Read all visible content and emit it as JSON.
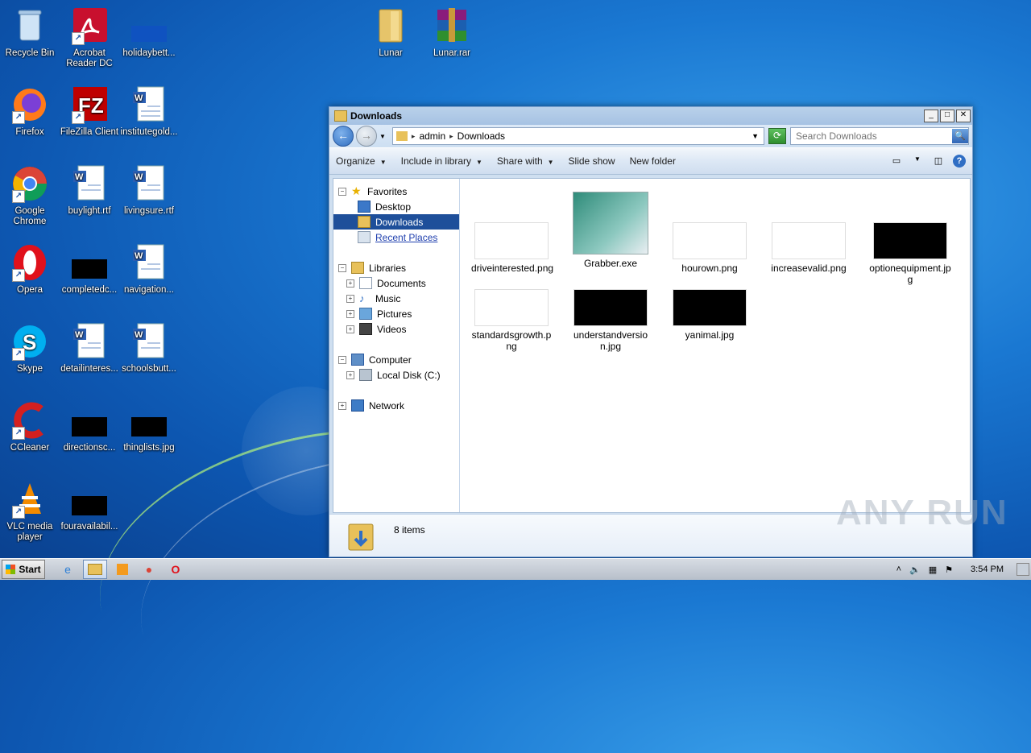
{
  "desktop": {
    "icons": [
      {
        "label": "Recycle Bin"
      },
      {
        "label": "Acrobat Reader DC"
      },
      {
        "label": "holidaybett..."
      },
      {
        "label": "Lunar"
      },
      {
        "label": "Lunar.rar"
      },
      {
        "label": "Firefox"
      },
      {
        "label": "FileZilla Client"
      },
      {
        "label": "institutegold..."
      },
      {
        "label": "Google Chrome"
      },
      {
        "label": "buylight.rtf"
      },
      {
        "label": "livingsure.rtf"
      },
      {
        "label": "Opera"
      },
      {
        "label": "completedc..."
      },
      {
        "label": "navigation..."
      },
      {
        "label": "Skype"
      },
      {
        "label": "detailinteres..."
      },
      {
        "label": "schoolsbutt..."
      },
      {
        "label": "CCleaner"
      },
      {
        "label": "directionsc..."
      },
      {
        "label": "thinglists.jpg"
      },
      {
        "label": "VLC media player"
      },
      {
        "label": "fouravailabil..."
      }
    ]
  },
  "window": {
    "title": "Downloads",
    "min_glyph": "_",
    "max_glyph": "□",
    "close_glyph": "✕",
    "breadcrumb": [
      "admin",
      "Downloads"
    ],
    "search": {
      "placeholder": "Search Downloads"
    },
    "toolbar": {
      "organize": "Organize",
      "include_in_library": "Include in library",
      "share_with": "Share with",
      "slide_show": "Slide show",
      "new_folder": "New folder"
    },
    "nav": {
      "favorites": "Favorites",
      "desktop": "Desktop",
      "downloads": "Downloads",
      "recent_places": "Recent Places",
      "libraries": "Libraries",
      "documents": "Documents",
      "music": "Music",
      "pictures": "Pictures",
      "videos": "Videos",
      "computer": "Computer",
      "local_disk": "Local Disk (C:)",
      "network": "Network"
    },
    "files": [
      {
        "name": "driveinterested.png"
      },
      {
        "name": "Grabber.exe"
      },
      {
        "name": "hourown.png"
      },
      {
        "name": "increasevalid.png"
      },
      {
        "name": "optionequipment.jpg"
      },
      {
        "name": "standardsgrowth.png"
      },
      {
        "name": "understandversion.jpg"
      },
      {
        "name": "yanimal.jpg"
      }
    ],
    "status": {
      "count": "8 items"
    }
  },
  "taskbar": {
    "start": "Start",
    "time": "3:54 PM"
  },
  "watermark": "ANY RUN",
  "colors": {
    "accent": "#1e4f9a",
    "window_frame": "#cfdff0"
  }
}
